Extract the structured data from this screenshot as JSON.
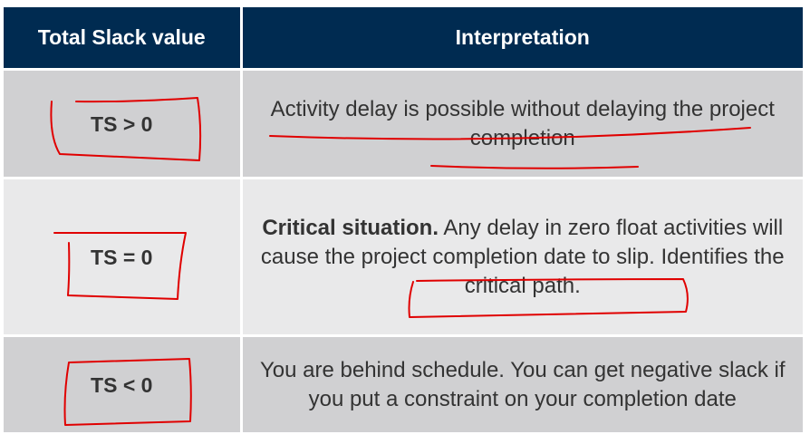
{
  "table": {
    "headers": [
      "Total Slack value",
      "Interpretation"
    ],
    "rows": [
      {
        "value": "TS > 0",
        "interpretation_lead": "",
        "interpretation": "Activity delay is possible without delaying the project completion"
      },
      {
        "value": "TS = 0",
        "interpretation_lead": "Critical situation.",
        "interpretation": " Any delay in zero float activities will cause the project completion date to slip. Identifies the critical path."
      },
      {
        "value": "TS < 0",
        "interpretation_lead": "",
        "interpretation": "You are behind schedule. You can get negative slack if you put a constraint on your completion date"
      }
    ]
  },
  "annotations": {
    "color": "#e00000",
    "style": "hand-drawn boxes and underlines"
  },
  "colors": {
    "header_bg": "#002b51",
    "row_dark": "#d0d0d2",
    "row_light": "#e9e9ea",
    "text": "#333333"
  }
}
